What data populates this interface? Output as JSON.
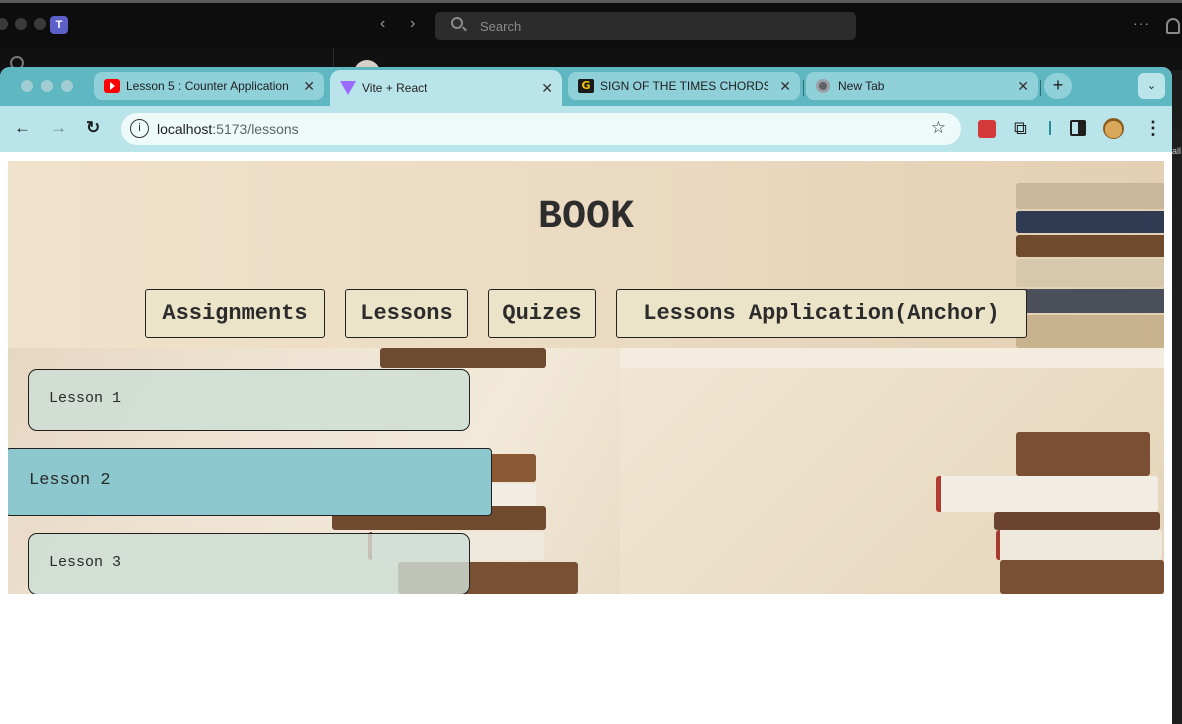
{
  "host_app": {
    "search_placeholder": "Search",
    "more_icon": "ellipsis-icon",
    "right_edge_text": "all"
  },
  "browser": {
    "tabs": [
      {
        "title": "Lesson 5 : Counter Application",
        "favicon": "youtube-icon",
        "active": false
      },
      {
        "title": "Vite + React",
        "favicon": "vite-icon",
        "active": true
      },
      {
        "title": "SIGN OF THE TIMES CHORDS",
        "favicon": "g-icon",
        "active": false
      },
      {
        "title": "New Tab",
        "favicon": "chrome-icon",
        "active": false
      }
    ],
    "close_glyph": "✕",
    "new_tab_glyph": "+",
    "tab_search_glyph": "⌄",
    "address": {
      "host": "localhost",
      "path": ":5173/lessons"
    },
    "toolbar_icons": {
      "back": "←",
      "forward": "→",
      "reload": "↻",
      "info": "i",
      "star": "☆",
      "extensions": "⧉",
      "menu": "⋮"
    }
  },
  "page": {
    "brand": "BOOK",
    "nav": [
      {
        "label": "Assignments"
      },
      {
        "label": "Lessons"
      },
      {
        "label": "Quizes"
      },
      {
        "label": "Lessons Application(Anchor)"
      }
    ],
    "lessons": [
      {
        "label": "Lesson 1",
        "selected": false
      },
      {
        "label": "Lesson 2",
        "selected": true
      },
      {
        "label": "Lesson 3",
        "selected": false
      }
    ]
  },
  "colors": {
    "tab_strip": "#5fb7c2",
    "toolbar": "#b9e4ea",
    "nav_button_bg": "#ece4c9",
    "selected_lesson_bg": "#8cc8cd"
  }
}
